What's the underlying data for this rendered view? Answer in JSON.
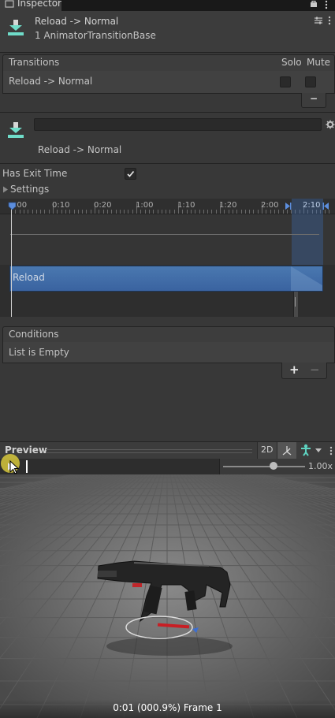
{
  "tab": {
    "label": "Inspector"
  },
  "header": {
    "title": "Reload -> Normal",
    "subtitle": "1 AnimatorTransitionBase"
  },
  "transitions": {
    "heading": "Transitions",
    "solo_label": "Solo",
    "mute_label": "Mute",
    "items": [
      {
        "label": "Reload -> Normal",
        "solo": false,
        "mute": false
      }
    ],
    "remove_label": "−"
  },
  "transition_settings": {
    "name_value": "",
    "caption": "Reload -> Normal",
    "has_exit_time_label": "Has Exit Time",
    "has_exit_time": true,
    "settings_label": "Settings"
  },
  "timeline": {
    "ticks": [
      ":00",
      "0:10",
      "0:20",
      "1:00",
      "1:10",
      "1:20",
      "2:00",
      "2:10"
    ],
    "clip_label": "Reload"
  },
  "conditions": {
    "heading": "Conditions",
    "empty_text": "List is Empty",
    "add_label": "+",
    "remove_label": "−"
  },
  "preview": {
    "title": "Preview",
    "mode_2d": "2D",
    "speed": "1.00x",
    "speed_fraction": 0.62,
    "status": "0:01 (000.9%) Frame 1"
  },
  "colors": {
    "panel": "#383838",
    "accent_blue": "#3a70b5",
    "icon_teal": "#5ed3c1"
  }
}
